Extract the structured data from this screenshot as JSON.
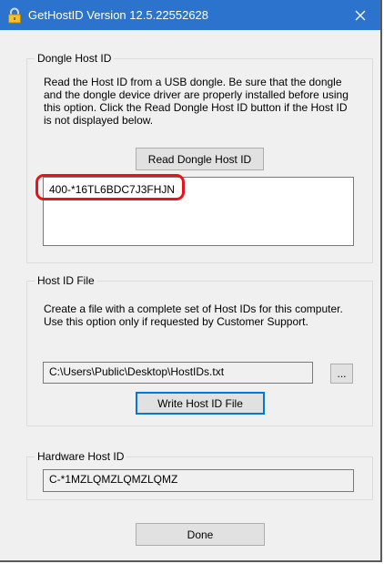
{
  "window": {
    "title": "GetHostID Version 12.5.22552628",
    "close_glyph": "✕"
  },
  "dongle": {
    "group_label": "Dongle Host ID",
    "description": "Read the Host ID from a USB dongle.  Be sure that the dongle\nand the dongle device driver are properly installed before using\nthis option.  Click the Read Dongle Host ID button if the Host ID\nis not displayed below.",
    "read_button_label": "Read Dongle Host ID",
    "host_id_value": "400-*16TL6BDC7J3FHJN"
  },
  "host_id_file": {
    "group_label": "Host ID File",
    "description": "Create a file with a complete set of Host IDs for this computer.\nUse this option only if requested by Customer Support.",
    "path_value": "C:\\Users\\Public\\Desktop\\HostIDs.txt",
    "browse_label": "...",
    "write_button_label": "Write Host ID File"
  },
  "hardware": {
    "group_label": "Hardware Host ID",
    "host_id_value": "C-*1MZLQMZLQMZLQMZ"
  },
  "footer": {
    "done_label": "Done"
  },
  "icons": {
    "title": "lock-icon",
    "close": "close-icon"
  },
  "colors": {
    "titlebar": "#2b73cc",
    "highlight": "#e8121a",
    "default_button_border": "#0078d7"
  }
}
